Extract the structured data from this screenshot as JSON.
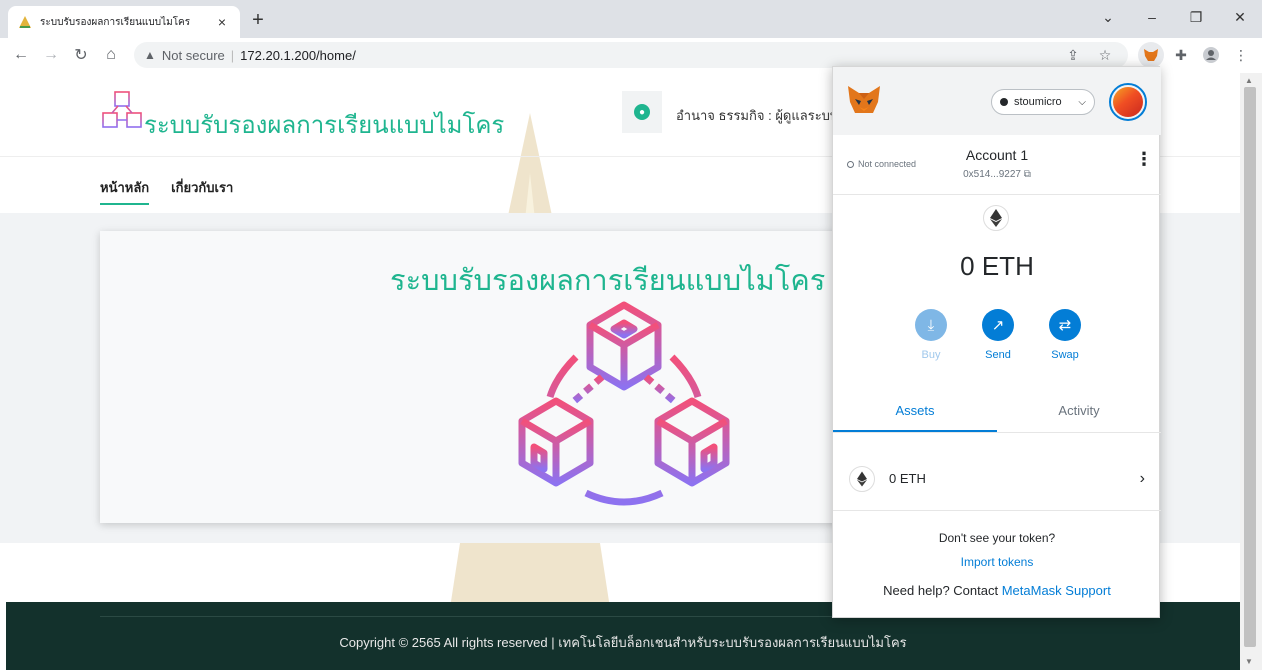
{
  "browser": {
    "tab_title": "ระบบรับรองผลการเรียนแบบไมโคร",
    "tab_close": "×",
    "new_tab": "+",
    "security_label": "Not secure",
    "url": "172.20.1.200/home/"
  },
  "site": {
    "title": "ระบบรับรองผลการเรียนแบบไมโคร",
    "user_label": "อำนาจ ธรรมกิจ : ผู้ดูแลระบบ",
    "nav": [
      {
        "label": "หน้าหลัก"
      },
      {
        "label": "เกี่ยวกับเรา"
      }
    ],
    "hero_title": "ระบบรับรองผลการเรียนแบบไมโคร",
    "footer_text": "Copyright © 2565 All rights reserved | เทคโนโลยีบล็อกเชนสำหรับระบบรับรองผลการเรียนแบบไมโคร",
    "accent_color": "#1fb58f",
    "footer_color": "#13312c"
  },
  "metamask": {
    "network": "stoumicro",
    "status": "Not connected",
    "account_name": "Account 1",
    "account_address": "0x514...9227",
    "balance": "0 ETH",
    "actions": [
      {
        "label": "Buy",
        "icon": "download-icon"
      },
      {
        "label": "Send",
        "icon": "arrow-up-right-icon"
      },
      {
        "label": "Swap",
        "icon": "swap-icon"
      }
    ],
    "tabs": [
      {
        "label": "Assets"
      },
      {
        "label": "Activity"
      }
    ],
    "asset": {
      "label": "0 ETH"
    },
    "help_question": "Don't see your token?",
    "import_link": "Import tokens",
    "need_help": "Need help? Contact",
    "support_link": "MetaMask Support",
    "accent_color": "#037dd6"
  }
}
